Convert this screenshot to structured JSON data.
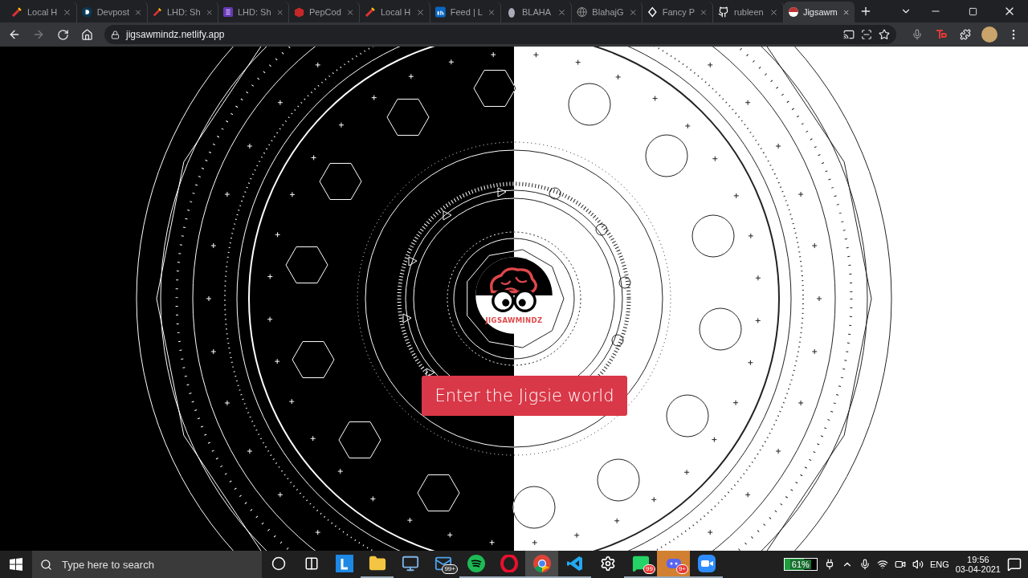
{
  "browser": {
    "tabs": [
      {
        "title": "Local H",
        "kind": "flag",
        "selected": false
      },
      {
        "title": "Devpost",
        "kind": "dcircle",
        "selected": false
      },
      {
        "title": "LHD: Sh",
        "kind": "flag",
        "selected": false
      },
      {
        "title": "LHD: Sh",
        "kind": "list",
        "selected": false
      },
      {
        "title": "PepCod",
        "kind": "box",
        "selected": false
      },
      {
        "title": "Local H",
        "kind": "flag",
        "selected": false
      },
      {
        "title": "Feed | L",
        "kind": "square",
        "selected": false
      },
      {
        "title": "BLAHA",
        "kind": "blob",
        "selected": false
      },
      {
        "title": "BlahajG",
        "kind": "globe",
        "selected": false
      },
      {
        "title": "Fancy P",
        "kind": "diamond",
        "selected": false
      },
      {
        "title": "rubleen",
        "kind": "github",
        "selected": false
      },
      {
        "title": "Jigsawm",
        "kind": "ball",
        "selected": true
      }
    ],
    "address": "jigsawmindz.netlify.app"
  },
  "page": {
    "logo_text": "JIGSAWMINDZ",
    "button": "Enter the Jigsie world"
  },
  "taskbar": {
    "search_placeholder": "Type here to search",
    "apps": [
      {
        "kind": "cortana",
        "running": false,
        "selected": false,
        "attention": false
      },
      {
        "kind": "taskview",
        "running": false,
        "selected": false,
        "attention": false
      },
      {
        "kind": "tile",
        "running": false,
        "selected": false,
        "attention": false
      },
      {
        "kind": "folder",
        "running": true,
        "selected": false,
        "attention": false
      },
      {
        "kind": "computer",
        "running": false,
        "selected": false,
        "attention": false
      },
      {
        "kind": "mail",
        "running": false,
        "selected": false,
        "attention": false,
        "badge": "99+"
      },
      {
        "kind": "spotify",
        "running": true,
        "selected": false,
        "attention": false
      },
      {
        "kind": "opera",
        "running": true,
        "selected": false,
        "attention": false
      },
      {
        "kind": "chrome",
        "running": true,
        "selected": true,
        "attention": false
      },
      {
        "kind": "vscode",
        "running": true,
        "selected": false,
        "attention": false
      },
      {
        "kind": "gear",
        "running": false,
        "selected": false,
        "attention": false
      },
      {
        "kind": "whatsapp",
        "running": true,
        "selected": false,
        "attention": false,
        "badge": "99"
      },
      {
        "kind": "discord",
        "running": true,
        "selected": false,
        "attention": true,
        "badge": "9+"
      },
      {
        "kind": "zoom",
        "running": true,
        "selected": false,
        "attention": false
      }
    ],
    "battery": {
      "level": 0.61,
      "reading": "61%"
    },
    "language": "ENG",
    "time": "19:56",
    "date": "03-04-2021"
  }
}
